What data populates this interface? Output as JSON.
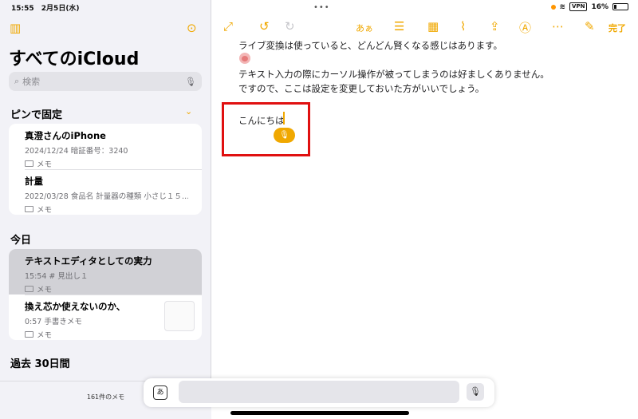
{
  "status": {
    "time": "15:55",
    "date": "2月5日(水)",
    "battery": "16%",
    "vpn": "VPN"
  },
  "sidebar": {
    "title": "すべてのiCloud",
    "search_placeholder": "検索",
    "pinned_header": "ピンで固定",
    "pinned": [
      {
        "title": "真澄さんのiPhone",
        "subtitle": "2024/12/24  暗証番号：3240",
        "folder": "メモ"
      },
      {
        "title": "計量",
        "subtitle": "2022/03/28  食品名 計量器の種類 小さじ１５…",
        "folder": "メモ"
      }
    ],
    "today_header": "今日",
    "today": [
      {
        "title": "テキストエディタとしての実力",
        "subtitle": "15:54  # 見出し１",
        "folder": "メモ"
      },
      {
        "title": "換え芯か使えないのか、",
        "subtitle": "0:57  手書きメモ",
        "folder": "メモ"
      }
    ],
    "past_header": "過去 30日間",
    "note_count": "161件のメモ"
  },
  "toolbar": {
    "format_label": "あぁ",
    "done_label": "完了"
  },
  "note": {
    "lines": [
      "ライブ変換は使っていると、どんどん賢くなる感じはあります。",
      "テキスト入力の際にカーソル操作が被ってしまうのは好ましくありません。",
      "ですので、ここは設定を変更しておいた方がいいでしょう。"
    ],
    "typed_text": "こんにちは"
  },
  "keyboard": {
    "input_mode": "あ"
  },
  "icons": {
    "sidebar_toggle": "sidebar-icon",
    "more": "ellipsis-icon",
    "expand": "expand-icon",
    "undo": "undo-icon",
    "redo": "redo-icon",
    "checklist": "checklist-icon",
    "table": "table-icon",
    "attach": "paperclip-icon",
    "share": "share-icon",
    "markup": "pen-icon",
    "compose": "compose-icon",
    "mic": "microphone-icon",
    "folder": "folder-icon"
  },
  "colors": {
    "accent": "#f0a800",
    "highlight": "#e01010"
  }
}
